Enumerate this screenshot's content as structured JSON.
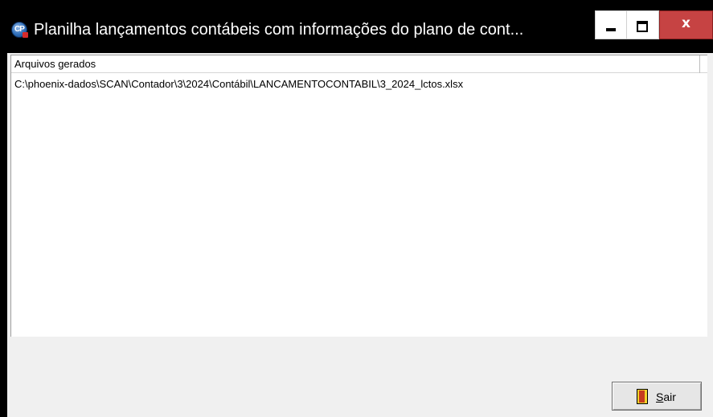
{
  "window": {
    "title": "Planilha lançamentos contábeis com informações do plano de cont...",
    "icon": "cp-app-icon",
    "icon_text": "CP",
    "controls": {
      "minimize_icon": "minimize-icon",
      "maximize_icon": "maximize-icon",
      "close_label": "x"
    }
  },
  "list": {
    "column_header": "Arquivos gerados",
    "rows": [
      "C:\\phoenix-dados\\SCAN\\Contador\\3\\2024\\Contábil\\LANCAMENTOCONTABIL\\3_2024_lctos.xlsx"
    ]
  },
  "footer": {
    "exit_button": {
      "icon": "door-exit-icon",
      "label_underlined": "S",
      "label_rest": "air"
    }
  },
  "colors": {
    "background": "#000000",
    "client": "#f0f0f0",
    "close_button": "#c64343"
  }
}
